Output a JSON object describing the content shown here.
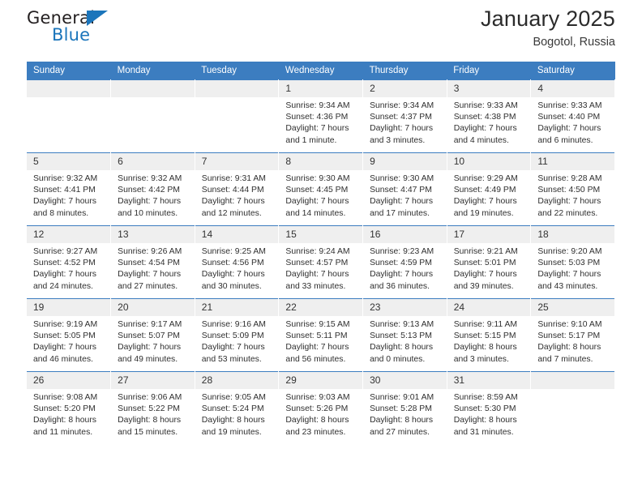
{
  "brand": {
    "name_part1": "General",
    "name_part2": "Blue",
    "triangle_icon": "triangle-icon",
    "accent_color": "#1b75bb"
  },
  "header": {
    "month_title": "January 2025",
    "location": "Bogotol, Russia"
  },
  "theme": {
    "header_blue": "#3c7dc0",
    "daynum_band": "#efefef",
    "text": "#2f2f2f"
  },
  "calendar": {
    "weekday_headers": [
      "Sunday",
      "Monday",
      "Tuesday",
      "Wednesday",
      "Thursday",
      "Friday",
      "Saturday"
    ],
    "labels": {
      "sunrise": "Sunrise:",
      "sunset": "Sunset:",
      "daylight": "Daylight:"
    },
    "weeks": [
      [
        {
          "day": "",
          "empty": true
        },
        {
          "day": "",
          "empty": true
        },
        {
          "day": "",
          "empty": true
        },
        {
          "day": "1",
          "sunrise": "Sunrise: 9:34 AM",
          "sunset": "Sunset: 4:36 PM",
          "daylight1": "Daylight: 7 hours",
          "daylight2": "and 1 minute."
        },
        {
          "day": "2",
          "sunrise": "Sunrise: 9:34 AM",
          "sunset": "Sunset: 4:37 PM",
          "daylight1": "Daylight: 7 hours",
          "daylight2": "and 3 minutes."
        },
        {
          "day": "3",
          "sunrise": "Sunrise: 9:33 AM",
          "sunset": "Sunset: 4:38 PM",
          "daylight1": "Daylight: 7 hours",
          "daylight2": "and 4 minutes."
        },
        {
          "day": "4",
          "sunrise": "Sunrise: 9:33 AM",
          "sunset": "Sunset: 4:40 PM",
          "daylight1": "Daylight: 7 hours",
          "daylight2": "and 6 minutes."
        }
      ],
      [
        {
          "day": "5",
          "sunrise": "Sunrise: 9:32 AM",
          "sunset": "Sunset: 4:41 PM",
          "daylight1": "Daylight: 7 hours",
          "daylight2": "and 8 minutes."
        },
        {
          "day": "6",
          "sunrise": "Sunrise: 9:32 AM",
          "sunset": "Sunset: 4:42 PM",
          "daylight1": "Daylight: 7 hours",
          "daylight2": "and 10 minutes."
        },
        {
          "day": "7",
          "sunrise": "Sunrise: 9:31 AM",
          "sunset": "Sunset: 4:44 PM",
          "daylight1": "Daylight: 7 hours",
          "daylight2": "and 12 minutes."
        },
        {
          "day": "8",
          "sunrise": "Sunrise: 9:30 AM",
          "sunset": "Sunset: 4:45 PM",
          "daylight1": "Daylight: 7 hours",
          "daylight2": "and 14 minutes."
        },
        {
          "day": "9",
          "sunrise": "Sunrise: 9:30 AM",
          "sunset": "Sunset: 4:47 PM",
          "daylight1": "Daylight: 7 hours",
          "daylight2": "and 17 minutes."
        },
        {
          "day": "10",
          "sunrise": "Sunrise: 9:29 AM",
          "sunset": "Sunset: 4:49 PM",
          "daylight1": "Daylight: 7 hours",
          "daylight2": "and 19 minutes."
        },
        {
          "day": "11",
          "sunrise": "Sunrise: 9:28 AM",
          "sunset": "Sunset: 4:50 PM",
          "daylight1": "Daylight: 7 hours",
          "daylight2": "and 22 minutes."
        }
      ],
      [
        {
          "day": "12",
          "sunrise": "Sunrise: 9:27 AM",
          "sunset": "Sunset: 4:52 PM",
          "daylight1": "Daylight: 7 hours",
          "daylight2": "and 24 minutes."
        },
        {
          "day": "13",
          "sunrise": "Sunrise: 9:26 AM",
          "sunset": "Sunset: 4:54 PM",
          "daylight1": "Daylight: 7 hours",
          "daylight2": "and 27 minutes."
        },
        {
          "day": "14",
          "sunrise": "Sunrise: 9:25 AM",
          "sunset": "Sunset: 4:56 PM",
          "daylight1": "Daylight: 7 hours",
          "daylight2": "and 30 minutes."
        },
        {
          "day": "15",
          "sunrise": "Sunrise: 9:24 AM",
          "sunset": "Sunset: 4:57 PM",
          "daylight1": "Daylight: 7 hours",
          "daylight2": "and 33 minutes."
        },
        {
          "day": "16",
          "sunrise": "Sunrise: 9:23 AM",
          "sunset": "Sunset: 4:59 PM",
          "daylight1": "Daylight: 7 hours",
          "daylight2": "and 36 minutes."
        },
        {
          "day": "17",
          "sunrise": "Sunrise: 9:21 AM",
          "sunset": "Sunset: 5:01 PM",
          "daylight1": "Daylight: 7 hours",
          "daylight2": "and 39 minutes."
        },
        {
          "day": "18",
          "sunrise": "Sunrise: 9:20 AM",
          "sunset": "Sunset: 5:03 PM",
          "daylight1": "Daylight: 7 hours",
          "daylight2": "and 43 minutes."
        }
      ],
      [
        {
          "day": "19",
          "sunrise": "Sunrise: 9:19 AM",
          "sunset": "Sunset: 5:05 PM",
          "daylight1": "Daylight: 7 hours",
          "daylight2": "and 46 minutes."
        },
        {
          "day": "20",
          "sunrise": "Sunrise: 9:17 AM",
          "sunset": "Sunset: 5:07 PM",
          "daylight1": "Daylight: 7 hours",
          "daylight2": "and 49 minutes."
        },
        {
          "day": "21",
          "sunrise": "Sunrise: 9:16 AM",
          "sunset": "Sunset: 5:09 PM",
          "daylight1": "Daylight: 7 hours",
          "daylight2": "and 53 minutes."
        },
        {
          "day": "22",
          "sunrise": "Sunrise: 9:15 AM",
          "sunset": "Sunset: 5:11 PM",
          "daylight1": "Daylight: 7 hours",
          "daylight2": "and 56 minutes."
        },
        {
          "day": "23",
          "sunrise": "Sunrise: 9:13 AM",
          "sunset": "Sunset: 5:13 PM",
          "daylight1": "Daylight: 8 hours",
          "daylight2": "and 0 minutes."
        },
        {
          "day": "24",
          "sunrise": "Sunrise: 9:11 AM",
          "sunset": "Sunset: 5:15 PM",
          "daylight1": "Daylight: 8 hours",
          "daylight2": "and 3 minutes."
        },
        {
          "day": "25",
          "sunrise": "Sunrise: 9:10 AM",
          "sunset": "Sunset: 5:17 PM",
          "daylight1": "Daylight: 8 hours",
          "daylight2": "and 7 minutes."
        }
      ],
      [
        {
          "day": "26",
          "sunrise": "Sunrise: 9:08 AM",
          "sunset": "Sunset: 5:20 PM",
          "daylight1": "Daylight: 8 hours",
          "daylight2": "and 11 minutes."
        },
        {
          "day": "27",
          "sunrise": "Sunrise: 9:06 AM",
          "sunset": "Sunset: 5:22 PM",
          "daylight1": "Daylight: 8 hours",
          "daylight2": "and 15 minutes."
        },
        {
          "day": "28",
          "sunrise": "Sunrise: 9:05 AM",
          "sunset": "Sunset: 5:24 PM",
          "daylight1": "Daylight: 8 hours",
          "daylight2": "and 19 minutes."
        },
        {
          "day": "29",
          "sunrise": "Sunrise: 9:03 AM",
          "sunset": "Sunset: 5:26 PM",
          "daylight1": "Daylight: 8 hours",
          "daylight2": "and 23 minutes."
        },
        {
          "day": "30",
          "sunrise": "Sunrise: 9:01 AM",
          "sunset": "Sunset: 5:28 PM",
          "daylight1": "Daylight: 8 hours",
          "daylight2": "and 27 minutes."
        },
        {
          "day": "31",
          "sunrise": "Sunrise: 8:59 AM",
          "sunset": "Sunset: 5:30 PM",
          "daylight1": "Daylight: 8 hours",
          "daylight2": "and 31 minutes."
        },
        {
          "day": "",
          "empty": true
        }
      ]
    ]
  }
}
